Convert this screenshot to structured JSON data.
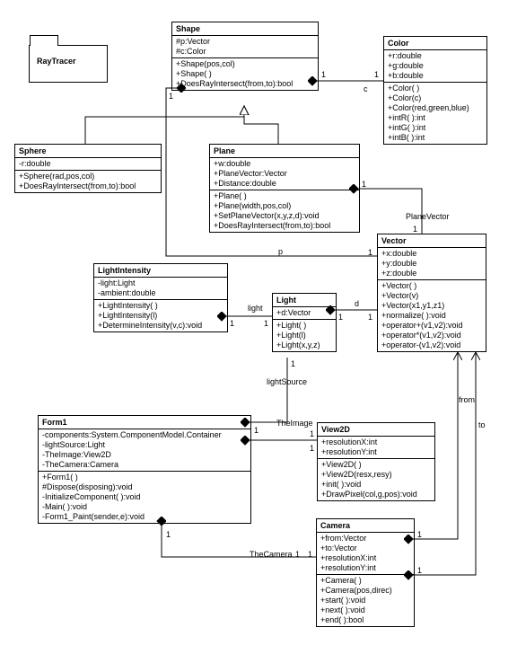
{
  "package": {
    "name": "RayTracer"
  },
  "classes": {
    "Shape": {
      "name": "Shape",
      "attrs": [
        "#p:Vector",
        "#c:Color"
      ],
      "ops": [
        "+Shape(pos,col)",
        "+Shape( )",
        "+DoesRayIntersect(from,to):bool"
      ]
    },
    "Color": {
      "name": "Color",
      "attrs": [
        "+r:double",
        "+g:double",
        "+b:double"
      ],
      "ops": [
        "+Color( )",
        "+Color(c)",
        "+Color(red,green,blue)",
        "+intR( ):int",
        "+intG( ):int",
        "+intB( ):int"
      ]
    },
    "Sphere": {
      "name": "Sphere",
      "attrs": [
        "-r:double"
      ],
      "ops": [
        "+Sphere(rad,pos,col)",
        "+DoesRayIntersect(from,to):bool"
      ]
    },
    "Plane": {
      "name": "Plane",
      "attrs": [
        "+w:double",
        "+PlaneVector:Vector",
        "+Distance:double"
      ],
      "ops": [
        "+Plane( )",
        "+Plane(width,pos,col)",
        "+SetPlaneVector(x,y,z,d):void",
        "+DoesRayIntersect(from,to):bool"
      ]
    },
    "Vector": {
      "name": "Vector",
      "attrs": [
        "+x:double",
        "+y:double",
        "+z:double"
      ],
      "ops": [
        "+Vector( )",
        "+Vector(v)",
        "+Vector(x1,y1,z1)",
        "+normalize( ):void",
        "+operator+(v1,v2):void",
        "+operator*(v1,v2):void",
        "+operator-(v1,v2):void"
      ]
    },
    "LightIntensity": {
      "name": "LightIntensity",
      "attrs": [
        "-light:Light",
        "-ambient:double"
      ],
      "ops": [
        "+LightIntensity( )",
        "+LightIntensity(l)",
        "+DetermineIntensity(v,c):void"
      ]
    },
    "Light": {
      "name": "Light",
      "attrs": [
        "+d:Vector"
      ],
      "ops": [
        "+Light( )",
        "+Light(l)",
        "+Light(x,y,z)"
      ]
    },
    "Form1": {
      "name": "Form1",
      "attrs": [
        "-components:System.ComponentModel.Container",
        "-lightSource:Light",
        "-TheImage:View2D",
        "-TheCamera:Camera"
      ],
      "ops": [
        "+Form1( )",
        "#Dispose(disposing):void",
        "-InitializeComponent( ):void",
        "-Main( ):void",
        "-Form1_Paint(sender,e):void"
      ]
    },
    "View2D": {
      "name": "View2D",
      "attrs": [
        "+resolutionX:int",
        "+resolutionY:int"
      ],
      "ops": [
        "+View2D( )",
        "+View2D(resx,resy)",
        "+init( ):void",
        "+DrawPixel(col,g,pos):void"
      ]
    },
    "Camera": {
      "name": "Camera",
      "attrs": [
        "+from:Vector",
        "+to:Vector",
        "+resolutionX:int",
        "+resolutionY:int"
      ],
      "ops": [
        "+Camera( )",
        "+Camera(pos,direc)",
        "+start( ):void",
        "+next( ):void",
        "+end( ):bool"
      ]
    }
  },
  "labels": {
    "one": "1",
    "c": "c",
    "p": "p",
    "d": "d",
    "light": "light",
    "planeVector": "PlaneVector",
    "lightSource": "lightSource",
    "TheImage": "TheImage",
    "TheCamera": "TheCamera",
    "from": "from",
    "to": "to"
  }
}
